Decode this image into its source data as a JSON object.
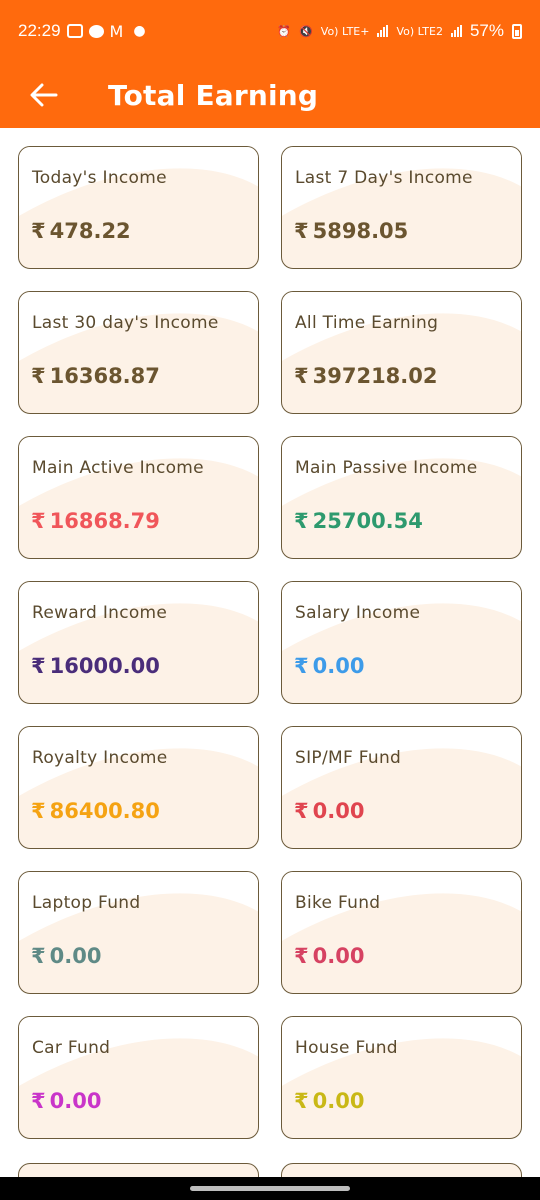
{
  "status_bar": {
    "time": "22:29",
    "battery": "57%",
    "network_1": "Vo) LTE+",
    "network_2": "Vo) LTE2"
  },
  "header": {
    "title": "Total Earning",
    "back_icon": "arrow-left-icon",
    "background": "#ff6a0d"
  },
  "currency_symbol": "₹",
  "cards": [
    {
      "label": "Today's Income",
      "value": "478.22",
      "color": "#6b5530"
    },
    {
      "label": "Last 7 Day's Income",
      "value": "5898.05",
      "color": "#6b5530"
    },
    {
      "label": "Last 30 day's Income",
      "value": "16368.87",
      "color": "#6b5530"
    },
    {
      "label": "All Time Earning",
      "value": "397218.02",
      "color": "#6b5530"
    },
    {
      "label": "Main Active Income",
      "value": "16868.79",
      "color": "#f0565a"
    },
    {
      "label": "Main Passive Income",
      "value": "25700.54",
      "color": "#2e9a6e"
    },
    {
      "label": "Reward Income",
      "value": "16000.00",
      "color": "#4a2d7a"
    },
    {
      "label": "Salary Income",
      "value": "0.00",
      "color": "#3d9be9"
    },
    {
      "label": "Royalty Income",
      "value": "86400.80",
      "color": "#f5a313"
    },
    {
      "label": "SIP/MF Fund",
      "value": "0.00",
      "color": "#e0454f"
    },
    {
      "label": "Laptop Fund",
      "value": "0.00",
      "color": "#5f8a86"
    },
    {
      "label": "Bike Fund",
      "value": "0.00",
      "color": "#d64262"
    },
    {
      "label": "Car Fund",
      "value": "0.00",
      "color": "#c935c9"
    },
    {
      "label": "House Fund",
      "value": "0.00",
      "color": "#c9b816"
    }
  ]
}
